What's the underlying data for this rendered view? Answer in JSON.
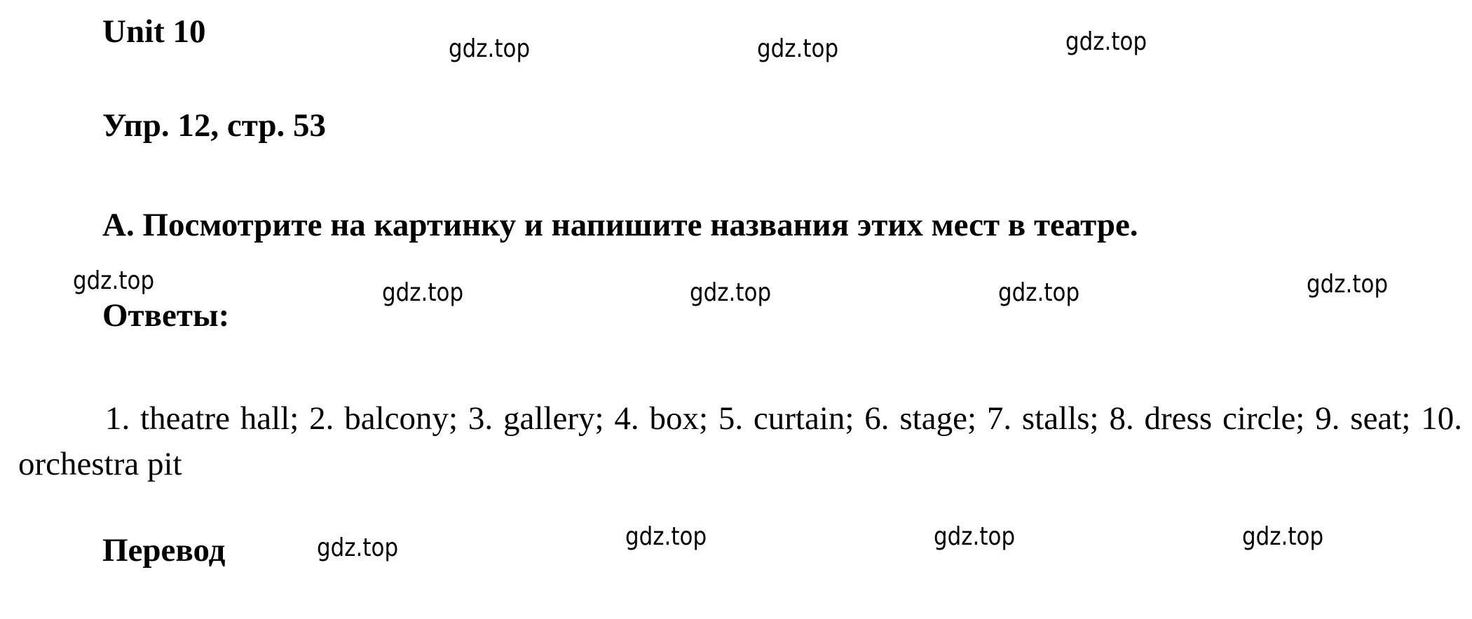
{
  "document": {
    "unit_title": "Unit 10",
    "exercise_ref": "Упр. 12, стр. 53",
    "task": "A. Посмотрите на картинку и напишите названия этих мест в театре.",
    "answers_heading": "Ответы:",
    "answers_text": "1. theatre hall; 2. balcony; 3. gallery; 4. box; 5. curtain; 6. stage; 7. stalls; 8. dress circle; 9. seat; 10. orchestra pit",
    "answers_list": [
      {
        "number": 1,
        "term": "theatre hall"
      },
      {
        "number": 2,
        "term": "balcony"
      },
      {
        "number": 3,
        "term": "gallery"
      },
      {
        "number": 4,
        "term": "box"
      },
      {
        "number": 5,
        "term": "curtain"
      },
      {
        "number": 6,
        "term": "stage"
      },
      {
        "number": 7,
        "term": "stalls"
      },
      {
        "number": 8,
        "term": "dress circle"
      },
      {
        "number": 9,
        "term": "seat"
      },
      {
        "number": 10,
        "term": "orchestra pit"
      }
    ],
    "translation_heading": "Перевод"
  },
  "watermarks": [
    "gdz.top",
    "gdz.top",
    "gdz.top",
    "gdz.top",
    "gdz.top",
    "gdz.top",
    "gdz.top",
    "gdz.top",
    "gdz.top",
    "gdz.top",
    "gdz.top",
    "gdz.top"
  ]
}
